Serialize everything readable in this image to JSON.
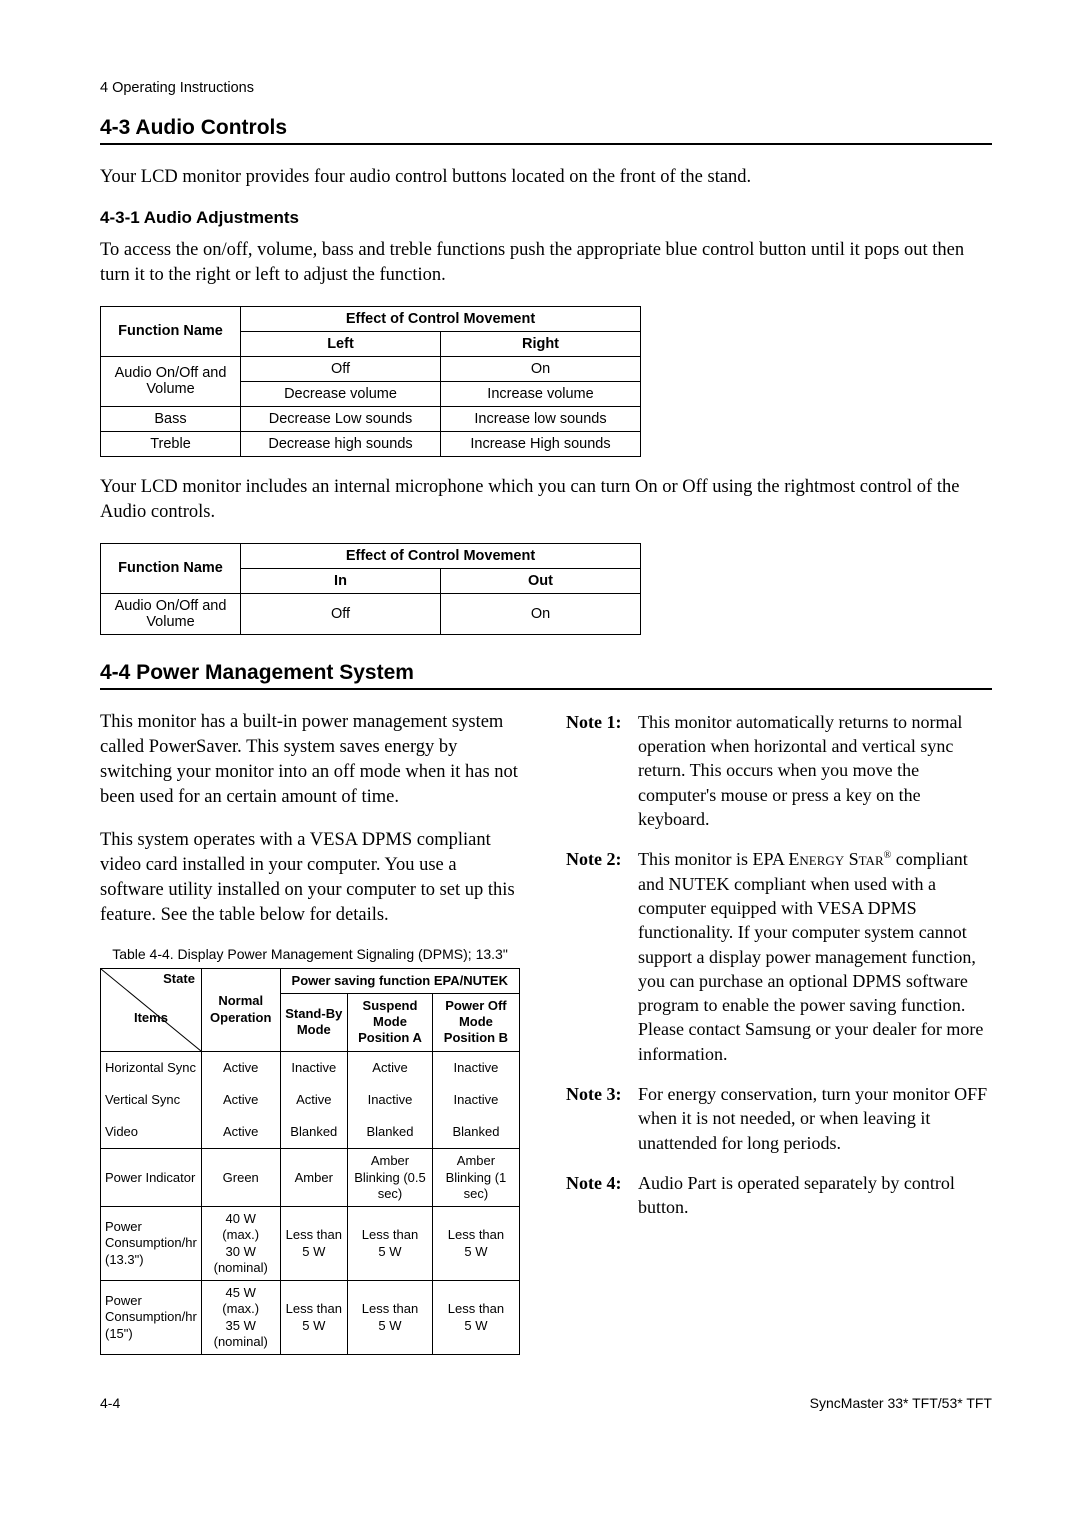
{
  "running_header": "4 Operating Instructions",
  "sec43": {
    "title": "4-3 Audio Controls",
    "intro": "Your LCD monitor provides four audio control buttons located on the front of the stand.",
    "sub": "4-3-1 Audio Adjustments",
    "sub_text": "To access the on/off, volume, bass and treble functions push the appropriate blue control button until it pops out then turn it to the right or left to adjust the function.",
    "table1": {
      "h_function": "Function Name",
      "h_effect": "Effect of Control Movement",
      "h_left": "Left",
      "h_right": "Right",
      "rows": [
        {
          "fn": "Audio On/Off and Volume",
          "left1": "Off",
          "right1": "On",
          "left2": "Decrease volume",
          "right2": "Increase volume"
        },
        {
          "fn": "Bass",
          "left": "Decrease Low sounds",
          "right": "Increase low sounds"
        },
        {
          "fn": "Treble",
          "left": "Decrease high sounds",
          "right": "Increase High sounds"
        }
      ]
    },
    "mic_text": "Your LCD monitor includes an internal microphone which you can turn On or Off using the rightmost control of the Audio controls.",
    "table2": {
      "h_function": "Function Name",
      "h_effect": "Effect of Control Movement",
      "h_in": "In",
      "h_out": "Out",
      "row": {
        "fn": "Audio On/Off and Volume",
        "in": "Off",
        "out": "On"
      }
    }
  },
  "sec44": {
    "title": "4-4 Power Management System",
    "p1": "This monitor has a built-in power management system called PowerSaver. This system saves energy by switching your monitor into an off mode when it has not been used for an certain amount of time.",
    "p2": "This system operates with a VESA DPMS compliant video card installed in your computer. You use a software utility installed on your computer to set up this feature. See the table below for details.",
    "caption": "Table 4-4. Display Power Management Signaling (DPMS); 13.3\"",
    "dpms": {
      "h_state": "State",
      "h_items": "Items",
      "h_normal": "Normal Operation",
      "h_saving": "Power saving function EPA/NUTEK",
      "h_standby": "Stand-By Mode",
      "h_suspend": "Suspend Mode Position A",
      "h_off": "Power Off Mode Position B",
      "rows": [
        {
          "item": "Horizontal Sync",
          "vals": [
            "Active",
            "Inactive",
            "Active",
            "Inactive"
          ]
        },
        {
          "item": "Vertical Sync",
          "vals": [
            "Active",
            "Active",
            "Inactive",
            "Inactive"
          ]
        },
        {
          "item": "Video",
          "vals": [
            "Active",
            "Blanked",
            "Blanked",
            "Blanked"
          ]
        },
        {
          "item": "Power Indicator",
          "vals": [
            "Green",
            "Amber",
            "Amber Blinking (0.5 sec)",
            "Amber Blinking (1 sec)"
          ]
        },
        {
          "item": "Power Consumption/hr (13.3\")",
          "vals": [
            "40 W (max.) 30 W (nominal)",
            "Less than 5 W",
            "Less than 5 W",
            "Less than 5 W"
          ]
        },
        {
          "item": "Power Consumption/hr (15\")",
          "vals": [
            "45 W (max.) 35 W (nominal)",
            "Less than 5 W",
            "Less than 5 W",
            "Less than 5 W"
          ]
        }
      ]
    },
    "notes": [
      {
        "label": "Note 1:",
        "text": "This monitor automatically returns to normal operation when horizontal and vertical sync return. This occurs when you move the computer's mouse or press a key on the keyboard."
      },
      {
        "label": "Note 2:",
        "text_pre": "This monitor is EPA ",
        "energy_star": "Energy Star",
        "text_post": " compliant and NUTEK compliant when used with a computer equipped with VESA DPMS functionality. If your computer system cannot support a display power management function, you can purchase an optional DPMS software program to enable the power saving function. Please contact Samsung or your dealer for more information."
      },
      {
        "label": "Note 3:",
        "text": "For energy conservation, turn your monitor OFF when it is not needed, or when leaving it unattended for long periods."
      },
      {
        "label": "Note 4:",
        "text": "Audio Part is operated separately by control button."
      }
    ]
  },
  "footer": {
    "left": "4-4",
    "right": "SyncMaster 33* TFT/53* TFT"
  }
}
